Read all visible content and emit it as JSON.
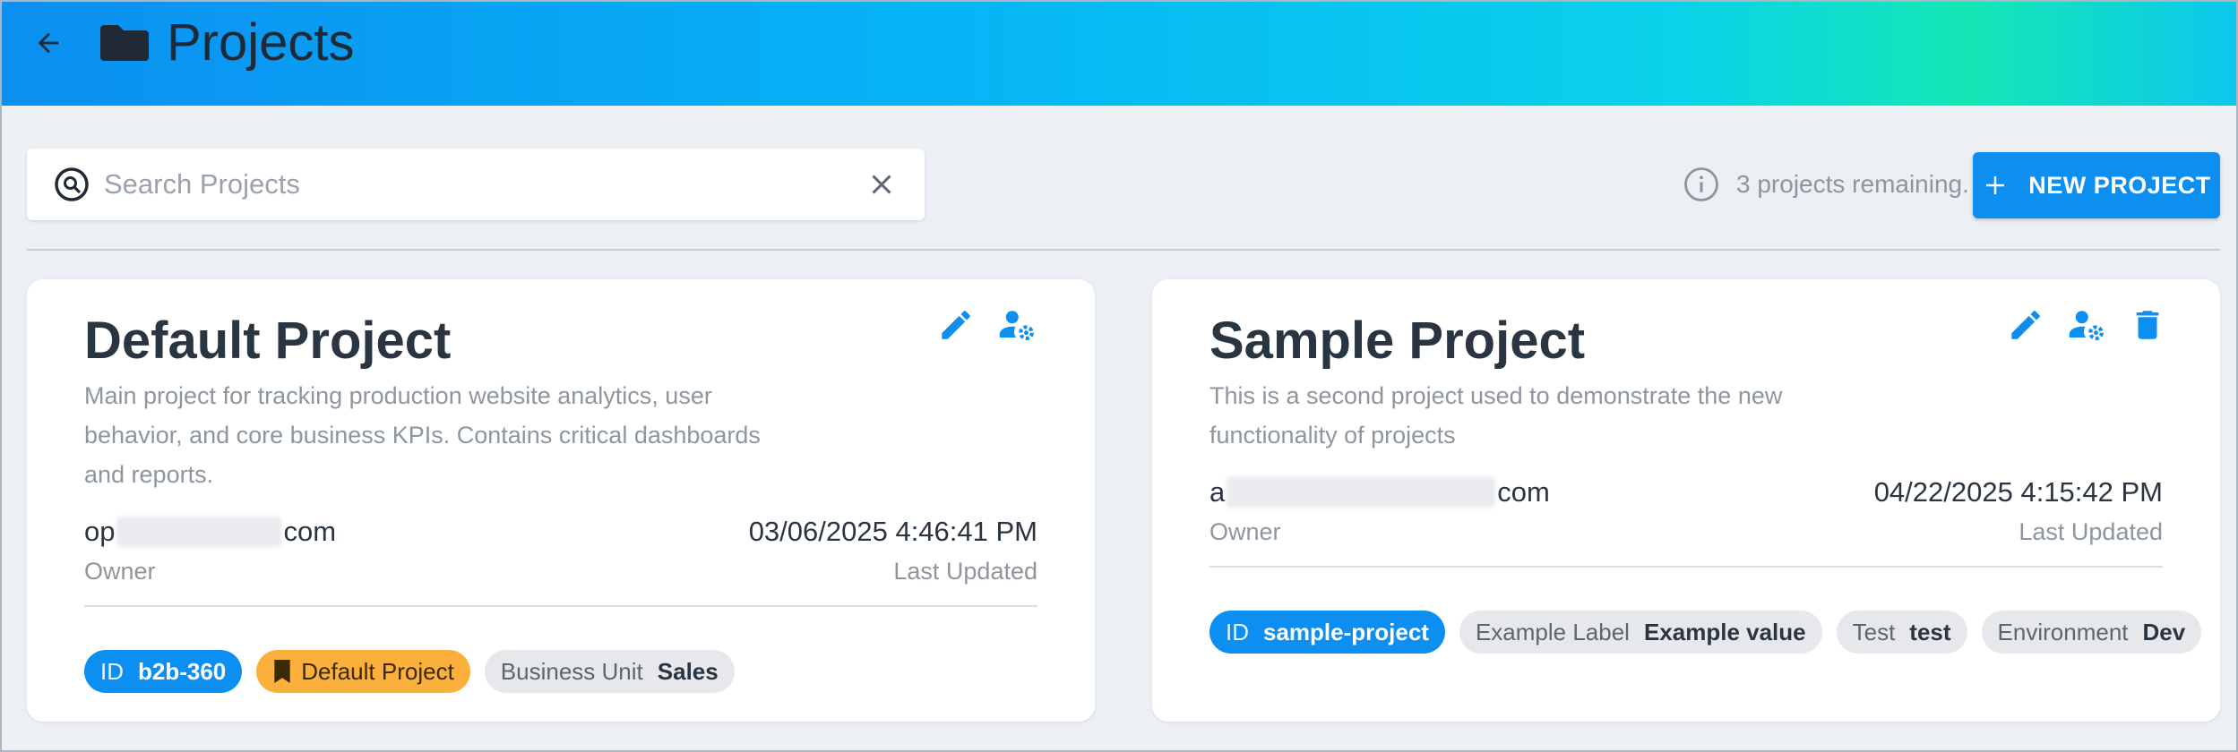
{
  "header": {
    "title": "Projects",
    "back_icon": "arrow-left-icon",
    "folder_icon": "folder-icon",
    "gradient": [
      "#0b8ff0",
      "#06b2f6",
      "#0ad2ea",
      "#14e7b4"
    ]
  },
  "toolbar": {
    "search_placeholder": "Search Projects",
    "search_value": "",
    "remaining_text": "3 projects remaining.",
    "new_project_label": "NEW PROJECT",
    "accent": "#0d8ff2"
  },
  "projects": [
    {
      "title": "Default Project",
      "description": "Main project for tracking production website analytics, user behavior, and core business KPIs. Contains critical dashboards and reports.",
      "owner_email_prefix": "op",
      "owner_email_suffix": "com",
      "owner_label": "Owner",
      "last_updated": "03/06/2025 4:46:41 PM",
      "last_updated_label": "Last Updated",
      "actions": [
        "edit-icon",
        "user-settings-icon"
      ],
      "id_key": "ID",
      "id_value": "b2b-360",
      "default_badge": "Default Project",
      "labels": [
        {
          "key": "Business Unit",
          "value": "Sales"
        }
      ]
    },
    {
      "title": "Sample Project",
      "description": "This is a second project used to demonstrate the new functionality of projects",
      "owner_email_prefix": "a",
      "owner_email_suffix": "com",
      "owner_label": "Owner",
      "last_updated": "04/22/2025 4:15:42 PM",
      "last_updated_label": "Last Updated",
      "actions": [
        "edit-icon",
        "user-settings-icon",
        "delete-icon"
      ],
      "id_key": "ID",
      "id_value": "sample-project",
      "labels": [
        {
          "key": "Example Label",
          "value": "Example value"
        },
        {
          "key": "Test",
          "value": "test"
        },
        {
          "key": "Environment",
          "value": "Dev"
        }
      ]
    }
  ]
}
